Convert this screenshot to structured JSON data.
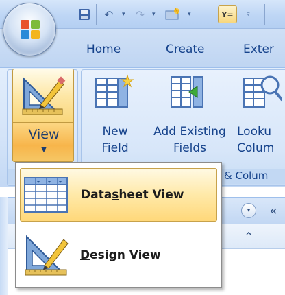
{
  "ribbon": {
    "tabs": [
      "Home",
      "Create",
      "Exter"
    ],
    "groups": {
      "views_label": "",
      "fields_label": "& Colum"
    },
    "view_button": {
      "label": "View"
    },
    "new_field": {
      "line1": "New",
      "line2": "Field"
    },
    "add_existing": {
      "line1": "Add Existing",
      "line2": "Fields"
    },
    "lookup": {
      "line1": "Looku",
      "line2": "Colum"
    }
  },
  "qat": {
    "active_label": "Y="
  },
  "menu": {
    "items": [
      {
        "pre": "Data",
        "key": "s",
        "post": "heet View"
      },
      {
        "pre": "",
        "key": "D",
        "post": "esign View"
      }
    ]
  },
  "nav": {
    "collapse_glyph": "«",
    "chevron_glyph": "▾",
    "up_glyph": "⌃"
  },
  "colors": {
    "ribbon_text": "#15428b",
    "highlight": "#ffd87a"
  }
}
